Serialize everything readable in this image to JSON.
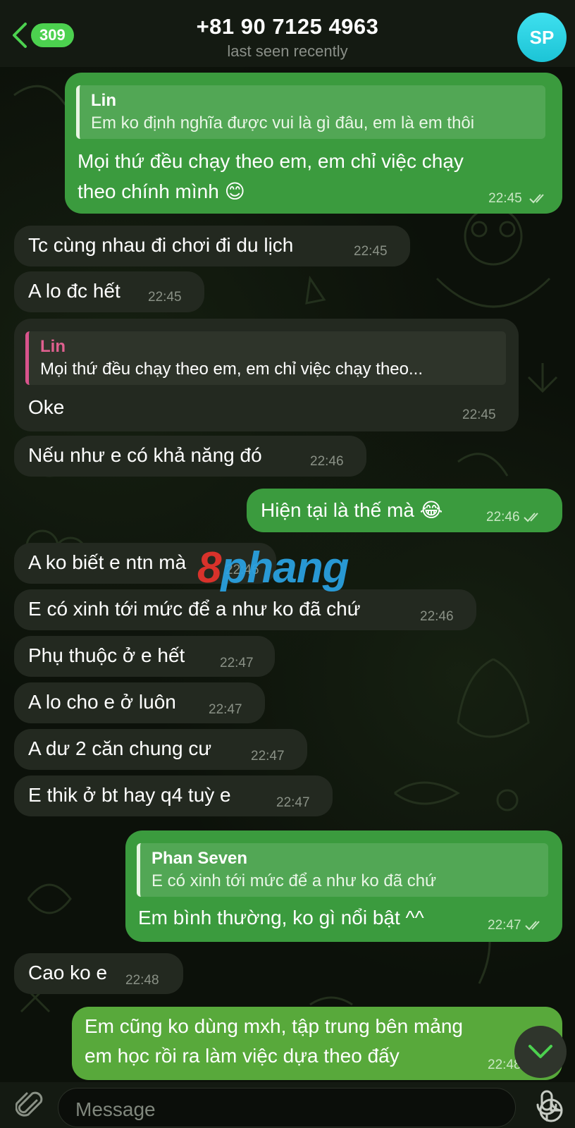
{
  "header": {
    "back_count": "309",
    "title": "+81 90 7125 4963",
    "subtitle": "last seen recently",
    "avatar_initials": "SP"
  },
  "messages": [
    {
      "dir": "out",
      "reply_name": "Lin",
      "reply_text": "Em ko định nghĩa được vui là gì đâu, em là em thôi",
      "lines": [
        "Mọi thứ đều chạy theo em, em chỉ việc chạy",
        "theo chính mình 😊"
      ],
      "time": "22:45",
      "read": true
    },
    {
      "dir": "in",
      "text": "Tc cùng nhau đi chơi đi du lịch",
      "time": "22:45"
    },
    {
      "dir": "in",
      "text": "A lo đc hết",
      "time": "22:45"
    },
    {
      "dir": "in",
      "reply_name": "Lin",
      "reply_text": "Mọi thứ đều chạy theo em, em chỉ việc chạy theo...",
      "text": "Oke",
      "time": "22:45"
    },
    {
      "dir": "in",
      "text": "Nếu như e có khả năng đó",
      "time": "22:46"
    },
    {
      "dir": "out",
      "text": "Hiện tại là thế mà 😂",
      "time": "22:46",
      "read": true
    },
    {
      "dir": "in",
      "text": "A ko biết e ntn mà",
      "time": "22:46"
    },
    {
      "dir": "in",
      "text": "E có xinh tới mức để a như ko đã chứ",
      "time": "22:46"
    },
    {
      "dir": "in",
      "text": "Phụ thuộc ở e hết",
      "time": "22:47"
    },
    {
      "dir": "in",
      "text": "A lo cho e ở luôn",
      "time": "22:47"
    },
    {
      "dir": "in",
      "text": "A dư 2 căn chung cư",
      "time": "22:47"
    },
    {
      "dir": "in",
      "text": "E thik ở bt hay q4 tuỳ e",
      "time": "22:47"
    },
    {
      "dir": "out",
      "reply_name": "Phan Seven",
      "reply_text": "E có xinh tới mức để a như ko đã chứ",
      "text": "Em bình thường, ko gì nổi bật ^^",
      "time": "22:47",
      "read": true
    },
    {
      "dir": "in",
      "text": "Cao ko e",
      "time": "22:48"
    },
    {
      "dir": "out",
      "lines": [
        "Em cũng ko dùng mxh, tập trung bên mảng",
        "em học rồi ra làm việc dựa theo đấy"
      ],
      "time": "22:48"
    }
  ],
  "watermark": {
    "part1": "8",
    "part2": "phang"
  },
  "input": {
    "placeholder": "Message"
  },
  "colors": {
    "outgoing": "#3b9b3e",
    "incoming": "#232920",
    "reply_accent_in": "#d9538c",
    "badge": "#4cd14f",
    "avatar": "#1cc4d6"
  }
}
